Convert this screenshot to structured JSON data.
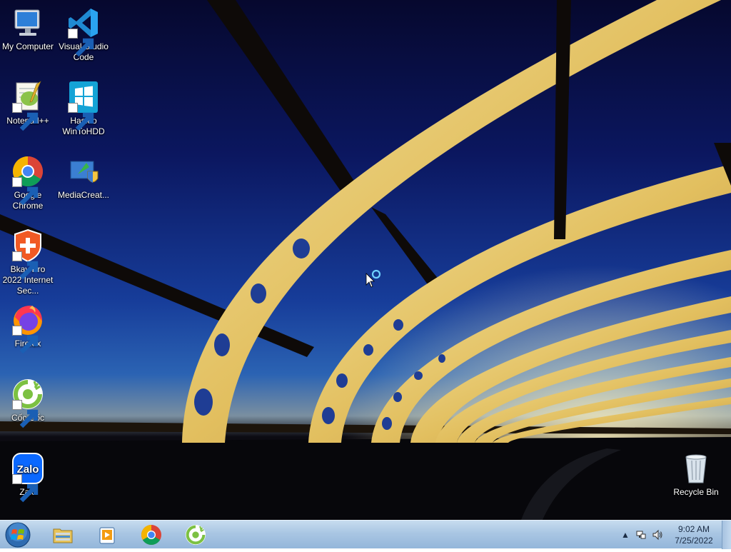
{
  "desktop": {
    "icons": [
      {
        "label": "My Computer",
        "icon": "computer-icon"
      },
      {
        "label": "Visual Studio Code",
        "icon": "vscode-icon"
      },
      {
        "label": "Notepad++",
        "icon": "notepad-plus-plus-icon"
      },
      {
        "label": "Hasleo WinToHDD",
        "icon": "hasleo-wintohdd-icon"
      },
      {
        "label": "Google Chrome",
        "icon": "chrome-icon"
      },
      {
        "label": "MediaCreat...",
        "icon": "media-creation-tool-icon"
      },
      {
        "label": "Bkav Pro 2022 Internet Sec...",
        "icon": "bkav-icon"
      },
      {
        "label": "Firefox",
        "icon": "firefox-icon"
      },
      {
        "label": "Cốc Cốc",
        "icon": "coccoc-icon"
      },
      {
        "label": "Zalo",
        "icon": "zalo-icon"
      },
      {
        "label": "Recycle Bin",
        "icon": "recycle-bin-icon"
      }
    ],
    "zalo_logo_text": "Zalo"
  },
  "taskbar": {
    "pinned": [
      {
        "name": "windows-explorer",
        "icon": "folder-icon"
      },
      {
        "name": "media-player",
        "icon": "media-player-icon"
      },
      {
        "name": "google-chrome",
        "icon": "chrome-icon"
      },
      {
        "name": "coc-coc",
        "icon": "coccoc-icon"
      }
    ],
    "tray": {
      "icons": [
        "show-hidden-icons-icon",
        "network-icon",
        "volume-icon"
      ]
    },
    "clock": {
      "time": "9:02 AM",
      "date": "7/25/2022"
    }
  },
  "colors": {
    "taskbar": "#a9c6e3",
    "sky_top": "#06082e",
    "sky_mid": "#173d9a",
    "bridge_gold": "#e7c86a"
  }
}
